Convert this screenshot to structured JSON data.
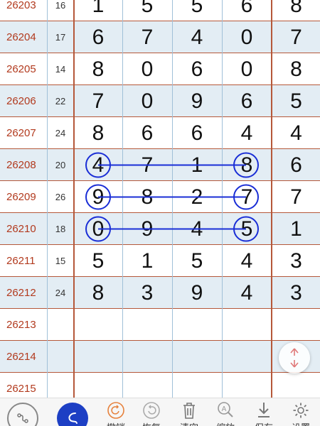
{
  "rows": [
    {
      "issue": "26203",
      "sum": "16",
      "nums": [
        "1",
        "5",
        "5",
        "6",
        "8"
      ],
      "shade": false
    },
    {
      "issue": "26204",
      "sum": "17",
      "nums": [
        "6",
        "7",
        "4",
        "0",
        "7"
      ],
      "shade": true
    },
    {
      "issue": "26205",
      "sum": "14",
      "nums": [
        "8",
        "0",
        "6",
        "0",
        "8"
      ],
      "shade": false
    },
    {
      "issue": "26206",
      "sum": "22",
      "nums": [
        "7",
        "0",
        "9",
        "6",
        "5"
      ],
      "shade": true
    },
    {
      "issue": "26207",
      "sum": "24",
      "nums": [
        "8",
        "6",
        "6",
        "4",
        "4"
      ],
      "shade": false
    },
    {
      "issue": "26208",
      "sum": "20",
      "nums": [
        "4",
        "7",
        "1",
        "8",
        "6"
      ],
      "shade": true
    },
    {
      "issue": "26209",
      "sum": "26",
      "nums": [
        "9",
        "8",
        "2",
        "7",
        "7"
      ],
      "shade": false
    },
    {
      "issue": "26210",
      "sum": "18",
      "nums": [
        "0",
        "9",
        "4",
        "5",
        "1"
      ],
      "shade": true
    },
    {
      "issue": "26211",
      "sum": "15",
      "nums": [
        "5",
        "1",
        "5",
        "4",
        "3"
      ],
      "shade": false
    },
    {
      "issue": "26212",
      "sum": "24",
      "nums": [
        "8",
        "3",
        "9",
        "4",
        "3"
      ],
      "shade": true
    },
    {
      "issue": "26213",
      "sum": "",
      "nums": [
        "",
        "",
        "",
        "",
        ""
      ],
      "shade": false
    },
    {
      "issue": "26214",
      "sum": "",
      "nums": [
        "",
        "",
        "",
        "",
        ""
      ],
      "shade": true
    },
    {
      "issue": "26215",
      "sum": "",
      "nums": [
        "",
        "",
        "",
        "",
        ""
      ],
      "shade": false
    }
  ],
  "marks": [
    {
      "row": 5,
      "from_col": 0,
      "to_col": 3
    },
    {
      "row": 6,
      "from_col": 0,
      "to_col": 3
    },
    {
      "row": 7,
      "from_col": 0,
      "to_col": 3
    }
  ],
  "colors": {
    "mark": "#1a2ed6",
    "issue": "#b23a1e",
    "grid_red": "#b5583a",
    "shade": "#e3edf4"
  },
  "toolbar": {
    "undo": "撤销",
    "redo": "恢复",
    "clear": "清空",
    "zoom": "缩放",
    "save": "保存",
    "settings": "设置"
  },
  "icons": [
    "pen-circle-icon",
    "pen-active-icon",
    "undo-icon",
    "redo-icon",
    "trash-icon",
    "zoom-icon",
    "download-icon",
    "gear-icon",
    "vertical-arrows-icon"
  ]
}
